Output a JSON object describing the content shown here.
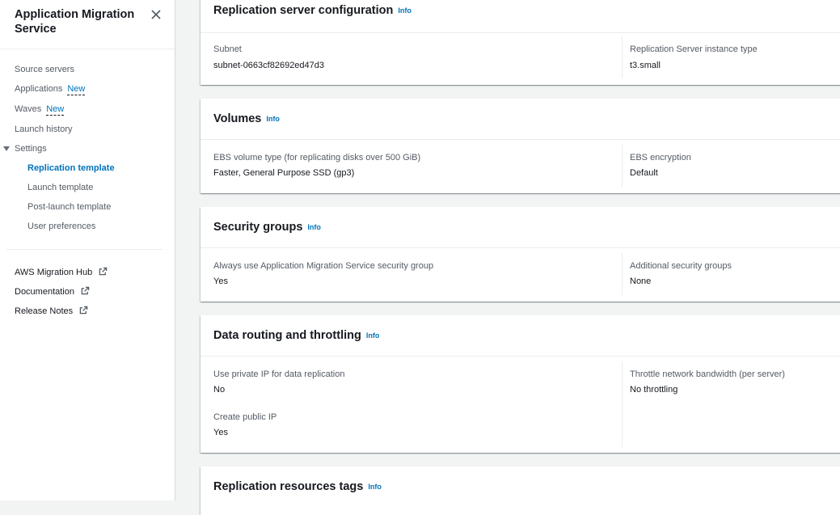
{
  "sidebar": {
    "title": "Application Migration Service",
    "items": [
      {
        "label": "Source servers"
      },
      {
        "label": "Applications",
        "badge": "New"
      },
      {
        "label": "Waves",
        "badge": "New"
      },
      {
        "label": "Launch history"
      },
      {
        "label": "Settings"
      }
    ],
    "settings_children": [
      {
        "label": "Replication template",
        "active": true
      },
      {
        "label": "Launch template"
      },
      {
        "label": "Post-launch template"
      },
      {
        "label": "User preferences"
      }
    ],
    "external_links": [
      {
        "label": "AWS Migration Hub",
        "icon": "external-link-icon"
      },
      {
        "label": "Documentation",
        "icon": "external-link-icon"
      },
      {
        "label": "Release Notes",
        "icon": "external-link-icon"
      }
    ]
  },
  "info_label": "Info",
  "sections": {
    "replication_server": {
      "title": "Replication server configuration",
      "subnet_label": "Subnet",
      "subnet_value": "subnet-0663cf82692ed47d3",
      "instance_type_label": "Replication Server instance type",
      "instance_type_value": "t3.small"
    },
    "volumes": {
      "title": "Volumes",
      "ebs_type_label": "EBS volume type (for replicating disks over 500 GiB)",
      "ebs_type_value": "Faster, General Purpose SSD (gp3)",
      "ebs_encryption_label": "EBS encryption",
      "ebs_encryption_value": "Default"
    },
    "security_groups": {
      "title": "Security groups",
      "always_use_label": "Always use Application Migration Service security group",
      "always_use_value": "Yes",
      "additional_label": "Additional security groups",
      "additional_value": "None"
    },
    "data_routing": {
      "title": "Data routing and throttling",
      "private_ip_label": "Use private IP for data replication",
      "private_ip_value": "No",
      "public_ip_label": "Create public IP",
      "public_ip_value": "Yes",
      "throttle_label": "Throttle network bandwidth (per server)",
      "throttle_value": "No throttling"
    },
    "tags": {
      "title": "Replication resources tags"
    }
  },
  "colors": {
    "link": "#0073bb",
    "background": "#f2f3f3",
    "text": "#16191f",
    "label": "#545b64"
  }
}
